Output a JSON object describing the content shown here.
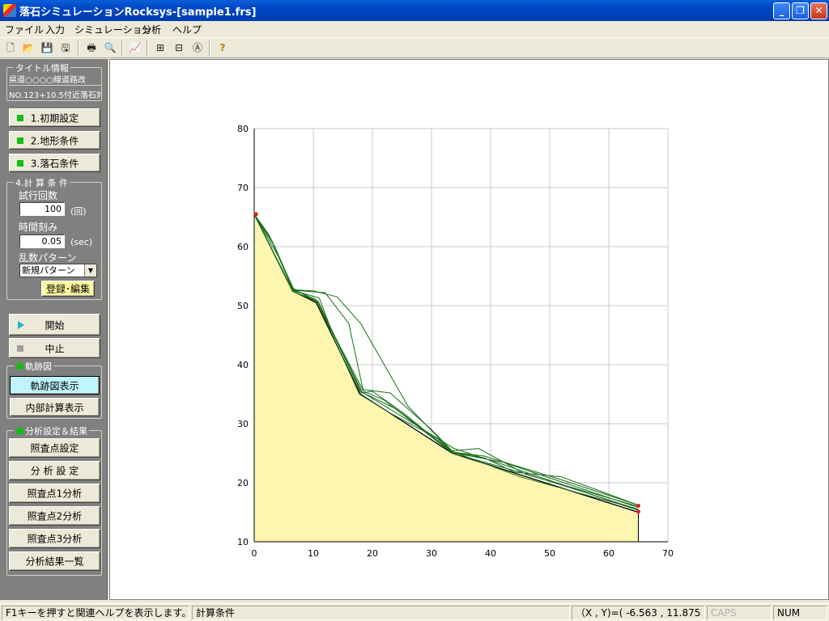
{
  "window": {
    "title": "落石シミュレーションRocksys-[sample1.frs]"
  },
  "menu": [
    "ファイル",
    "入力",
    "シミュレーション",
    "分析",
    "ヘルプ"
  ],
  "toolbar": [
    "new-icon",
    "open-icon",
    "save-icon",
    "save-as-icon",
    "print-icon",
    "preview-icon",
    "graph-icon",
    "grid-icon",
    "grid-h-icon",
    "text-zoom-icon",
    "help-icon"
  ],
  "panel": {
    "title_group": "タイトル情報",
    "title_line1": "県道○○○○線道路改",
    "title_line2": "NO.123+10.5付近落石対",
    "btn_initial": "1.初期設定",
    "btn_terrain": "2.地形条件",
    "btn_rock": "3.落石条件",
    "calc_group": "4.計 算 条 件",
    "trials_label": "試行回数",
    "trials_value": "100",
    "trials_unit": "(回)",
    "timestep_label": "時間刻み",
    "timestep_value": "0.05",
    "timestep_unit": "(sec)",
    "random_label": "乱数パターン",
    "random_value": "新規パターン",
    "register_btn": "登録･編集",
    "start_btn": "開始",
    "stop_btn": "中止",
    "trajectory_group": "軌跡図",
    "show_trajectory_btn": "軌跡図表示",
    "show_internal_btn": "内部計算表示",
    "analysis_group": "分析設定＆結果",
    "check_point_btn": "照査点設定",
    "analysis_setting_btn": "分 析 設 定",
    "cp1_btn": "照査点1分析",
    "cp2_btn": "照査点2分析",
    "cp3_btn": "照査点3分析",
    "results_btn": "分析結果一覧"
  },
  "status": {
    "help": "F1キーを押すと関連ヘルプを表示します。",
    "mode": "計算条件",
    "coords": "（X , Y)=( -6.563 , 11.875 ）",
    "caps": "CAPS",
    "num": "NUM"
  },
  "colors": {
    "terrain_fill": "#fdf5b0",
    "trajectory": "#1a6e1a",
    "endpoint": "#e02020"
  },
  "chart_data": {
    "type": "line",
    "xlim": [
      0,
      70
    ],
    "ylim": [
      10,
      80
    ],
    "x_ticks": [
      0,
      10,
      20,
      30,
      40,
      50,
      60,
      70
    ],
    "y_ticks": [
      10,
      20,
      30,
      40,
      50,
      60,
      70,
      80
    ],
    "grid": true,
    "terrain": [
      [
        0,
        65.5
      ],
      [
        6.5,
        52.5
      ],
      [
        10.5,
        50.5
      ],
      [
        18,
        35
      ],
      [
        33.5,
        25
      ],
      [
        65,
        15
      ]
    ],
    "trajectories": [
      [
        [
          0,
          65.5
        ],
        [
          3.5,
          60
        ],
        [
          6.5,
          52.8
        ],
        [
          10.5,
          51
        ],
        [
          18.3,
          35.3
        ],
        [
          24,
          32.5
        ],
        [
          33.5,
          25.3
        ],
        [
          45,
          21
        ],
        [
          65,
          15.5
        ]
      ],
      [
        [
          0,
          65.5
        ],
        [
          2.5,
          62
        ],
        [
          6.5,
          53
        ],
        [
          10.8,
          50.5
        ],
        [
          18,
          35.5
        ],
        [
          27,
          30
        ],
        [
          33.8,
          25.8
        ],
        [
          40,
          23.8
        ],
        [
          65,
          15.3
        ]
      ],
      [
        [
          0,
          65.5
        ],
        [
          3,
          61
        ],
        [
          6.8,
          52.5
        ],
        [
          11,
          51.3
        ],
        [
          13,
          46
        ],
        [
          18.5,
          35.5
        ],
        [
          22,
          34
        ],
        [
          33.5,
          25
        ],
        [
          46,
          21.5
        ],
        [
          65,
          15.5
        ]
      ],
      [
        [
          0,
          65.5
        ],
        [
          4,
          58.5
        ],
        [
          6.6,
          52.6
        ],
        [
          12,
          52.2
        ],
        [
          16,
          47
        ],
        [
          18.4,
          35.8
        ],
        [
          23,
          35.2
        ],
        [
          30,
          29
        ],
        [
          33.5,
          25.4
        ],
        [
          38,
          25.8
        ],
        [
          46,
          21.4
        ],
        [
          65,
          16
        ]
      ],
      [
        [
          0,
          65.5
        ],
        [
          6.5,
          52.7
        ],
        [
          10,
          52.5
        ],
        [
          14,
          51.5
        ],
        [
          18,
          47
        ],
        [
          22,
          40
        ],
        [
          26,
          33
        ],
        [
          33.5,
          25.2
        ],
        [
          39,
          24.5
        ],
        [
          52,
          20.5
        ],
        [
          65,
          16.2
        ]
      ],
      [
        [
          0,
          65.5
        ],
        [
          6.5,
          52.4
        ],
        [
          10.8,
          50.8
        ],
        [
          18.2,
          35.2
        ],
        [
          20,
          35.5
        ],
        [
          25,
          32
        ],
        [
          33.5,
          25.1
        ],
        [
          42,
          23.5
        ],
        [
          50,
          20.8
        ],
        [
          65,
          15.8
        ]
      ],
      [
        [
          0,
          65.5
        ],
        [
          6.5,
          52.5
        ],
        [
          10.7,
          50.6
        ],
        [
          17.8,
          35
        ],
        [
          23,
          31.8
        ],
        [
          31,
          27.5
        ],
        [
          33.6,
          25.2
        ],
        [
          39,
          24.2
        ],
        [
          44,
          21.8
        ],
        [
          52,
          21
        ],
        [
          65,
          16.2
        ]
      ]
    ],
    "endpoints": [
      [
        0.3,
        65.5
      ],
      [
        65,
        16.1
      ],
      [
        65,
        15.1
      ]
    ]
  }
}
